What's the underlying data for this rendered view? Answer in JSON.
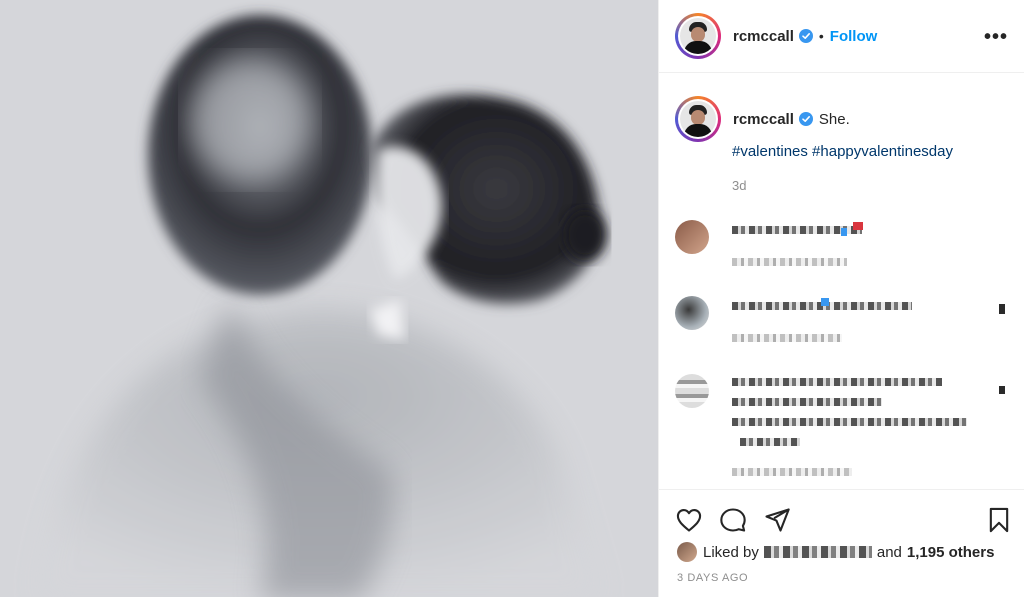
{
  "post": {
    "image_alt": "Watercolor of two figures kissing",
    "author": "rcmccall",
    "follow_label": "Follow",
    "dot": "•",
    "more_label": "•••"
  },
  "caption": {
    "author": "rcmccall",
    "text": "She.",
    "hashtags": "#valentines #happyvalentinesday",
    "age": "3d"
  },
  "comments": [
    {
      "avatar_color": "#b7876c"
    },
    {
      "avatar_color": "#9aa0a7"
    },
    {
      "avatar_color": "#bdbdbd"
    }
  ],
  "footer": {
    "liked_by": "Liked by",
    "and_label": "and",
    "others": "1,195 others",
    "date": "3 DAYS AGO"
  },
  "icons": [
    "heart-icon",
    "comment-icon",
    "share-icon",
    "bookmark-icon",
    "verified-icon",
    "more-icon"
  ],
  "colors": {
    "accent": "#0095f6",
    "hashtag": "#00376b",
    "muted": "#8e8e8e"
  }
}
